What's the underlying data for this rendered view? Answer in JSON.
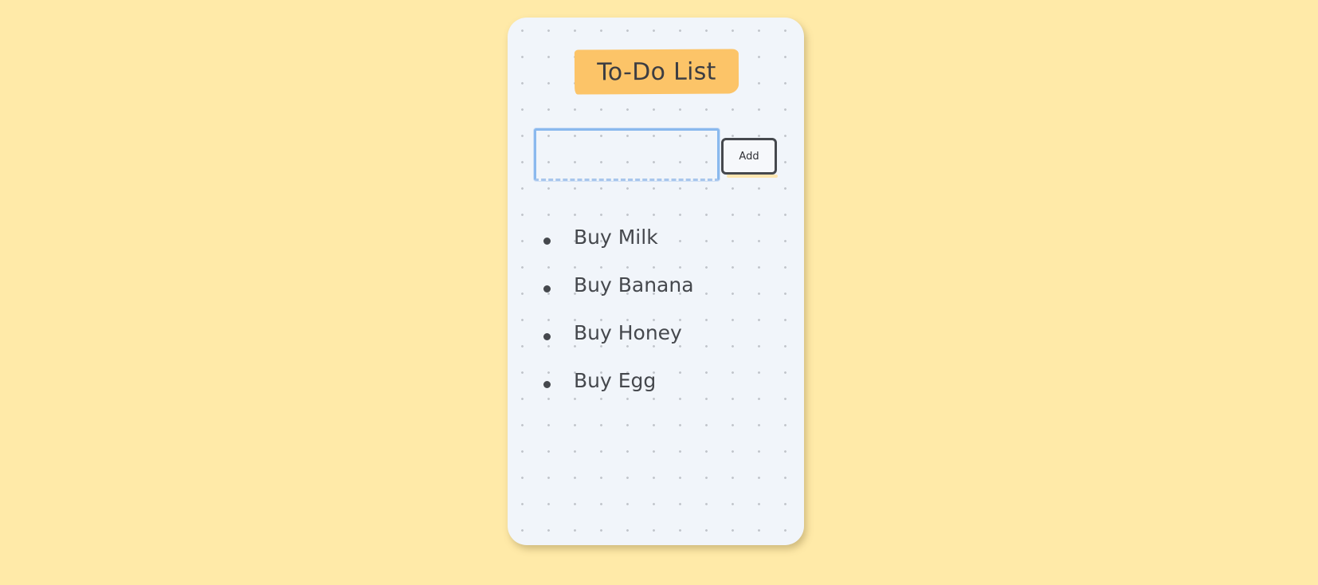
{
  "app": {
    "title": "To-Do List"
  },
  "form": {
    "input_value": "",
    "input_placeholder": "",
    "add_label": "Add"
  },
  "todos": [
    {
      "label": "Buy Milk"
    },
    {
      "label": "Buy Banana"
    },
    {
      "label": "Buy Honey"
    },
    {
      "label": "Buy Egg"
    }
  ],
  "colors": {
    "page_background": "#ffeaa8",
    "card_background": "#f1f5fa",
    "title_highlight": "#fcc468",
    "input_focus_border": "#8ab9ee",
    "text": "#45484d"
  }
}
